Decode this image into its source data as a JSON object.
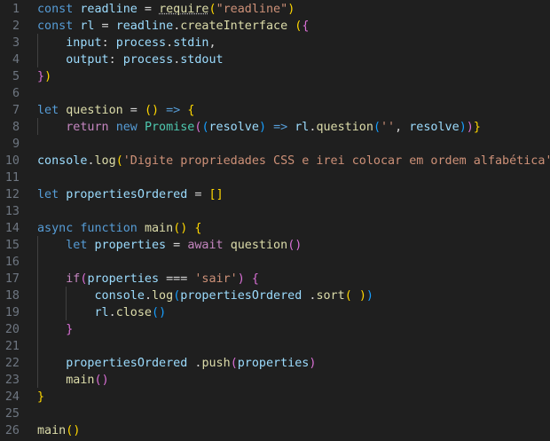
{
  "editor": {
    "lines": [
      {
        "n": "1",
        "tokens": [
          [
            "kw",
            "const"
          ],
          [
            "op",
            " "
          ],
          [
            "var",
            "readline"
          ],
          [
            "op",
            " = "
          ],
          [
            "fn sq",
            "require"
          ],
          [
            "b1",
            "("
          ],
          [
            "str",
            "\"readline\""
          ],
          [
            "b1",
            ")"
          ]
        ]
      },
      {
        "n": "2",
        "tokens": [
          [
            "kw",
            "const"
          ],
          [
            "op",
            " "
          ],
          [
            "var",
            "rl"
          ],
          [
            "op",
            " = "
          ],
          [
            "var",
            "readline"
          ],
          [
            "op",
            "."
          ],
          [
            "fn",
            "createInterface"
          ],
          [
            "op",
            " "
          ],
          [
            "b1",
            "("
          ],
          [
            "b2",
            "{"
          ]
        ]
      },
      {
        "n": "3",
        "tokens": [
          [
            "op",
            "    "
          ],
          [
            "var",
            "input"
          ],
          [
            "op",
            ": "
          ],
          [
            "var",
            "process"
          ],
          [
            "op",
            "."
          ],
          [
            "var",
            "stdin"
          ],
          [
            "op",
            ","
          ]
        ]
      },
      {
        "n": "4",
        "tokens": [
          [
            "op",
            "    "
          ],
          [
            "var",
            "output"
          ],
          [
            "op",
            ": "
          ],
          [
            "var",
            "process"
          ],
          [
            "op",
            "."
          ],
          [
            "var",
            "stdout"
          ]
        ]
      },
      {
        "n": "5",
        "tokens": [
          [
            "b2",
            "}"
          ],
          [
            "b1",
            ")"
          ]
        ]
      },
      {
        "n": "6",
        "tokens": []
      },
      {
        "n": "7",
        "tokens": [
          [
            "kw",
            "let"
          ],
          [
            "op",
            " "
          ],
          [
            "fn",
            "question"
          ],
          [
            "op",
            " = "
          ],
          [
            "b1",
            "("
          ],
          [
            "b1",
            ")"
          ],
          [
            "op",
            " "
          ],
          [
            "kw",
            "=>"
          ],
          [
            "op",
            " "
          ],
          [
            "b1",
            "{"
          ]
        ]
      },
      {
        "n": "8",
        "tokens": [
          [
            "op",
            "    "
          ],
          [
            "ctl",
            "return"
          ],
          [
            "op",
            " "
          ],
          [
            "kw",
            "new"
          ],
          [
            "op",
            " "
          ],
          [
            "cls",
            "Promise"
          ],
          [
            "b2",
            "("
          ],
          [
            "b3",
            "("
          ],
          [
            "var",
            "resolve"
          ],
          [
            "b3",
            ")"
          ],
          [
            "op",
            " "
          ],
          [
            "kw",
            "=>"
          ],
          [
            "op",
            " "
          ],
          [
            "var",
            "rl"
          ],
          [
            "op",
            "."
          ],
          [
            "fn",
            "question"
          ],
          [
            "b3",
            "("
          ],
          [
            "str",
            "''"
          ],
          [
            "op",
            ", "
          ],
          [
            "var",
            "resolve"
          ],
          [
            "b3",
            ")"
          ],
          [
            "b2",
            ")"
          ],
          [
            "b1",
            "}"
          ]
        ]
      },
      {
        "n": "9",
        "tokens": []
      },
      {
        "n": "10",
        "tokens": [
          [
            "var",
            "console"
          ],
          [
            "op",
            "."
          ],
          [
            "fn",
            "log"
          ],
          [
            "b1",
            "("
          ],
          [
            "str",
            "'Digite propriedades CSS e irei colocar em ordem alfabética'"
          ],
          [
            "b1",
            ")"
          ]
        ]
      },
      {
        "n": "11",
        "tokens": []
      },
      {
        "n": "12",
        "tokens": [
          [
            "kw",
            "let"
          ],
          [
            "op",
            " "
          ],
          [
            "var",
            "propertiesOrdered"
          ],
          [
            "op",
            " = "
          ],
          [
            "b1",
            "["
          ],
          [
            "b1",
            "]"
          ]
        ]
      },
      {
        "n": "13",
        "tokens": []
      },
      {
        "n": "14",
        "tokens": [
          [
            "kw",
            "async"
          ],
          [
            "op",
            " "
          ],
          [
            "kw",
            "function"
          ],
          [
            "op",
            " "
          ],
          [
            "fn",
            "main"
          ],
          [
            "b1",
            "("
          ],
          [
            "b1",
            ")"
          ],
          [
            "op",
            " "
          ],
          [
            "b1",
            "{"
          ]
        ]
      },
      {
        "n": "15",
        "tokens": [
          [
            "op",
            "    "
          ],
          [
            "kw",
            "let"
          ],
          [
            "op",
            " "
          ],
          [
            "var",
            "properties"
          ],
          [
            "op",
            " = "
          ],
          [
            "ctl",
            "await"
          ],
          [
            "op",
            " "
          ],
          [
            "fn",
            "question"
          ],
          [
            "b2",
            "("
          ],
          [
            "b2",
            ")"
          ]
        ]
      },
      {
        "n": "16",
        "tokens": []
      },
      {
        "n": "17",
        "tokens": [
          [
            "op",
            "    "
          ],
          [
            "ctl",
            "if"
          ],
          [
            "b2",
            "("
          ],
          [
            "var",
            "properties"
          ],
          [
            "op",
            " === "
          ],
          [
            "str",
            "'sair'"
          ],
          [
            "b2",
            ")"
          ],
          [
            "op",
            " "
          ],
          [
            "b2",
            "{"
          ]
        ]
      },
      {
        "n": "18",
        "tokens": [
          [
            "op",
            "        "
          ],
          [
            "var",
            "console"
          ],
          [
            "op",
            "."
          ],
          [
            "fn",
            "log"
          ],
          [
            "b3",
            "("
          ],
          [
            "var",
            "propertiesOrdered"
          ],
          [
            "op",
            " ."
          ],
          [
            "fn",
            "sort"
          ],
          [
            "b1",
            "("
          ],
          [
            "op",
            " "
          ],
          [
            "b1",
            ")"
          ],
          [
            "b3",
            ")"
          ]
        ]
      },
      {
        "n": "19",
        "tokens": [
          [
            "op",
            "        "
          ],
          [
            "var",
            "rl"
          ],
          [
            "op",
            "."
          ],
          [
            "fn",
            "close"
          ],
          [
            "b3",
            "("
          ],
          [
            "b3",
            ")"
          ]
        ]
      },
      {
        "n": "20",
        "tokens": [
          [
            "op",
            "    "
          ],
          [
            "b2",
            "}"
          ]
        ]
      },
      {
        "n": "21",
        "tokens": []
      },
      {
        "n": "22",
        "tokens": [
          [
            "op",
            "    "
          ],
          [
            "var",
            "propertiesOrdered"
          ],
          [
            "op",
            " ."
          ],
          [
            "fn",
            "push"
          ],
          [
            "b2",
            "("
          ],
          [
            "var",
            "properties"
          ],
          [
            "b2",
            ")"
          ]
        ]
      },
      {
        "n": "23",
        "tokens": [
          [
            "op",
            "    "
          ],
          [
            "fn",
            "main"
          ],
          [
            "b2",
            "("
          ],
          [
            "b2",
            ")"
          ]
        ]
      },
      {
        "n": "24",
        "tokens": [
          [
            "b1",
            "}"
          ]
        ]
      },
      {
        "n": "25",
        "tokens": []
      },
      {
        "n": "26",
        "tokens": [
          [
            "fn",
            "main"
          ],
          [
            "b1",
            "("
          ],
          [
            "b1",
            ")"
          ]
        ]
      }
    ]
  }
}
